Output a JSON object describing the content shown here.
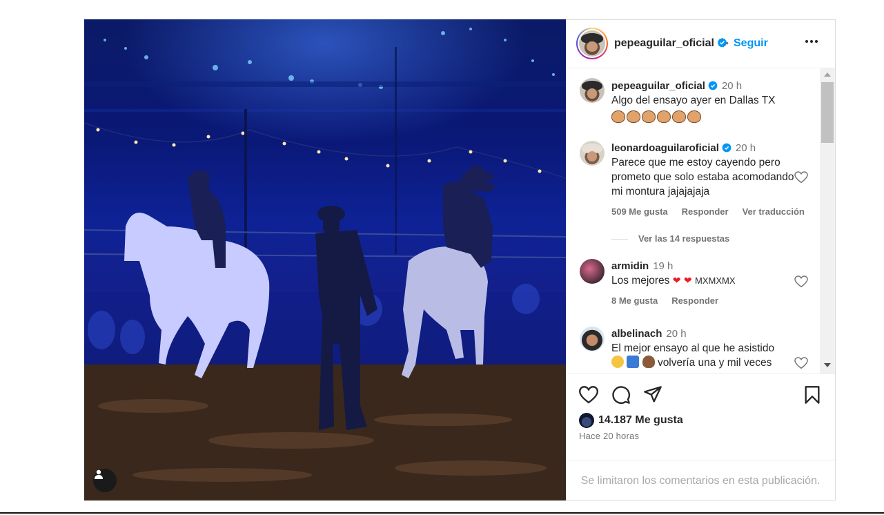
{
  "post": {
    "username": "pepeaguilar_oficial",
    "separator": "•",
    "follow_label": "Seguir"
  },
  "comments": [
    {
      "username": "pepeaguilar_oficial",
      "time": "20 h",
      "text": "Algo del ensayo ayer en Dallas TX",
      "emoji_names": [
        "fist-emoji",
        "fist-emoji",
        "thumbs-up-emoji",
        "thumbs-up-emoji",
        "fist-emoji",
        "fist-emoji"
      ]
    },
    {
      "username": "leonardoaguilaroficial",
      "time": "20 h",
      "text": "Parece que me estoy cayendo pero prometo que solo estaba acomodando mi montura jajajajaja",
      "likes": "509 Me gusta",
      "reply": "Responder",
      "translate": "Ver traducción",
      "view_replies": "Ver las 14 respuestas"
    },
    {
      "username": "armidin",
      "time": "19 h",
      "text": "Los mejores",
      "emoji_text": "❤ ❤",
      "suffix": "MXMXMX",
      "likes": "8 Me gusta",
      "reply": "Responder"
    },
    {
      "username": "albelinach",
      "time": "20 h",
      "text_line1": "El mejor ensayo al que he asistido",
      "text_line2": "volvería una y mil veces",
      "emoji_names": [
        "star-struck-emoji",
        "top-arrow-emoji",
        "woman-emoji"
      ]
    }
  ],
  "actions": {
    "likes": "14.187 Me gusta",
    "time_ago": "Hace 20 horas"
  },
  "footer": {
    "limited_comments": "Se limitaron los comentarios en esta publicación."
  },
  "colors": {
    "accent": "#0095f6",
    "verified": "#0095f6",
    "muted": "#737373"
  }
}
